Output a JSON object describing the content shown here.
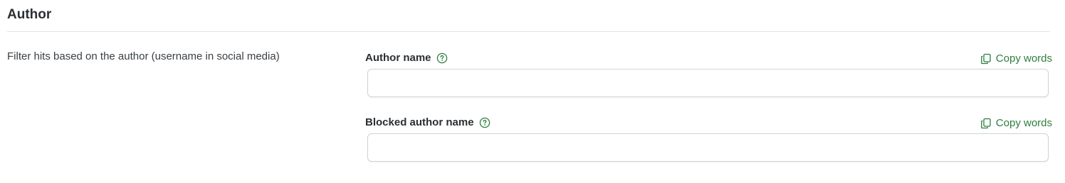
{
  "section": {
    "title": "Author",
    "description": "Filter hits based on the author (username in social media)"
  },
  "fields": {
    "author_name": {
      "label": "Author name",
      "help_icon": "question-circle-icon",
      "copy_label": "Copy words",
      "copy_icon": "copy-icon",
      "value": "",
      "placeholder": ""
    },
    "blocked_author_name": {
      "label": "Blocked author name",
      "help_icon": "question-circle-icon",
      "copy_label": "Copy words",
      "copy_icon": "copy-icon",
      "value": "",
      "placeholder": ""
    }
  },
  "colors": {
    "accent": "#2e7d3e",
    "text": "#2b2f33",
    "border": "#cfd3d7",
    "divider": "#e3e5e8"
  }
}
